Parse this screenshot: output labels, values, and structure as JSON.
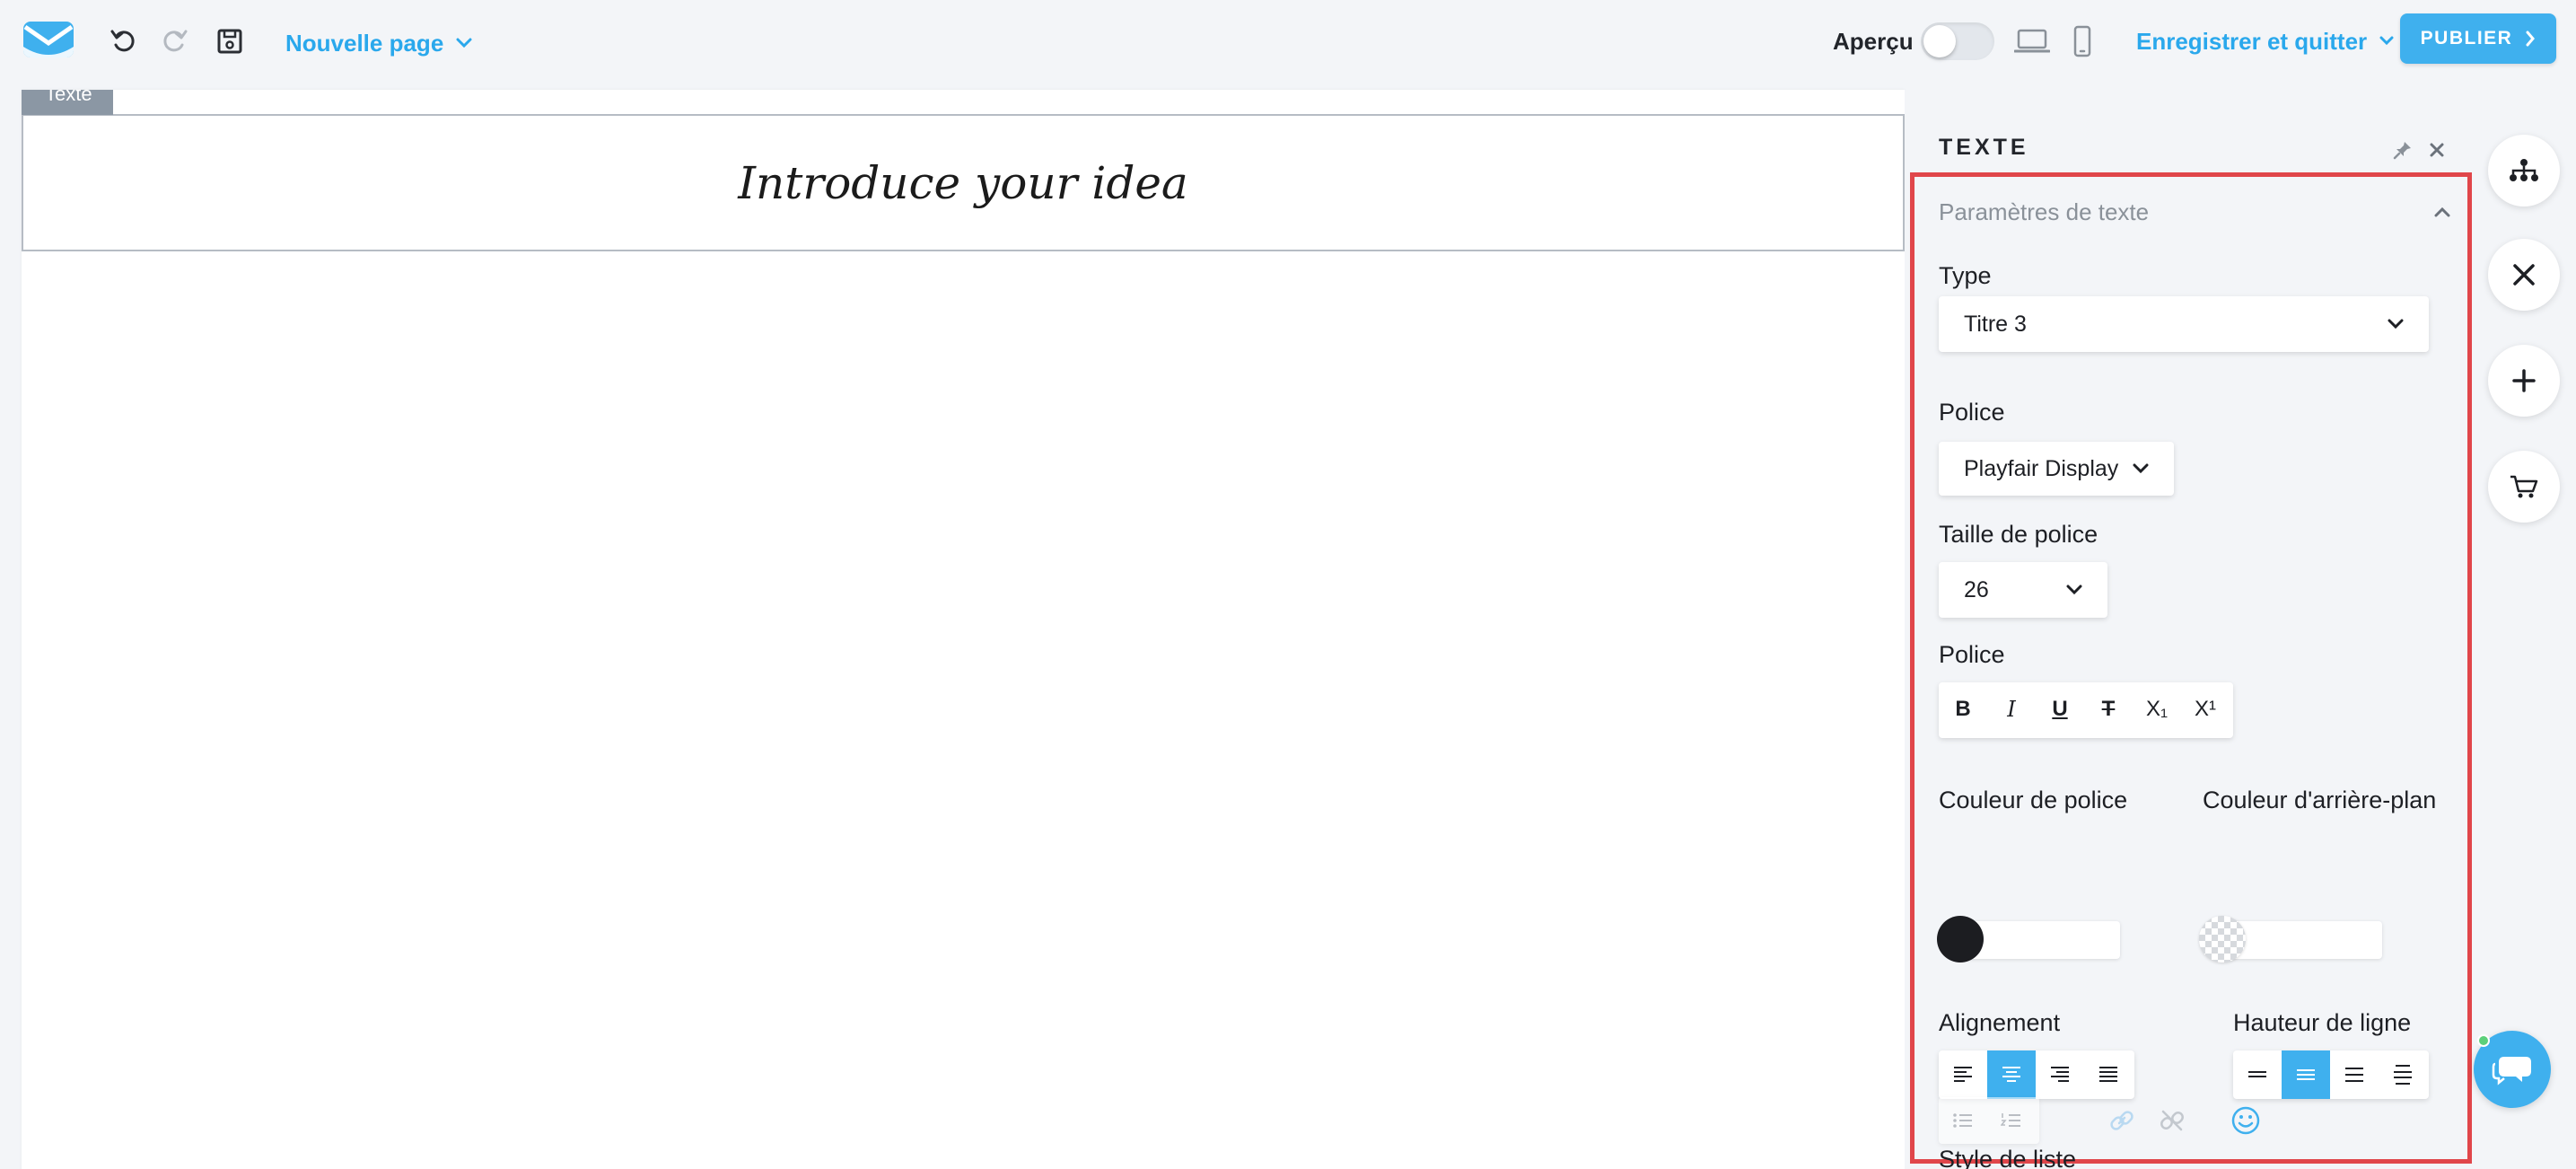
{
  "toolbar": {
    "page_name": "Nouvelle page",
    "preview_label": "Aperçu",
    "preview_on": false,
    "save_quit_label": "Enregistrer et quitter",
    "publish_label": "PUBLIER"
  },
  "canvas": {
    "element_tag": "Texte",
    "heading_text": "Introduce your idea"
  },
  "panel": {
    "title": "TEXTE",
    "section_title": "Paramètres de texte",
    "type_label": "Type",
    "type_value": "Titre 3",
    "font_label": "Police",
    "font_value": "Playfair Display",
    "size_label": "Taille de police",
    "size_value": "26",
    "style_label": "Police",
    "style_buttons": [
      "B",
      "I",
      "U",
      "T",
      "X₁",
      "X¹"
    ],
    "font_color_label": "Couleur de police",
    "font_color": "#1c1d21",
    "bg_color_label": "Couleur d'arrière-plan",
    "align_label": "Alignement",
    "align_active": "center",
    "line_height_label": "Hauteur de ligne",
    "line_height_active": 1,
    "list_style_label": "Style de liste"
  },
  "colors": {
    "accent": "#3fb0ee",
    "highlight": "#e0464a"
  }
}
